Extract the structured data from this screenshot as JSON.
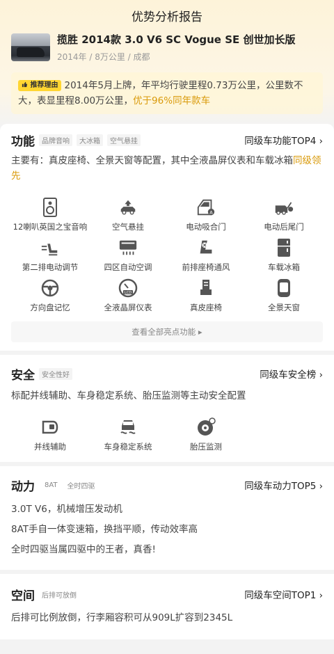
{
  "page": {
    "title": "优势分析报告"
  },
  "car": {
    "name": "揽胜 2014款 3.0 V6 SC Vogue SE 创世加长版",
    "meta": "2014年 / 8万公里 / 成都"
  },
  "reason": {
    "badge": "推荐理由",
    "text": "2014年5月上牌，年平均行驶里程0.73万公里，公里数不大，表显里程8.00万公里，",
    "highlight": "优于96%同年款车"
  },
  "function": {
    "title": "功能",
    "tags": [
      "品牌音响",
      "大冰箱",
      "空气悬挂"
    ],
    "rank_link": "同级车功能TOP4 ›",
    "desc": "主要有：真皮座椅、全景天窗等配置，其中全液晶屏仪表和车载冰箱",
    "desc_highlight": "同级领先",
    "features": [
      {
        "label": "12喇叭英国之宝音响",
        "icon": "speaker-icon"
      },
      {
        "label": "空气悬挂",
        "icon": "air-suspension-icon"
      },
      {
        "label": "电动吸合门",
        "icon": "soft-close-door-icon"
      },
      {
        "label": "电动后尾门",
        "icon": "power-tailgate-icon"
      },
      {
        "label": "第二排电动调节",
        "icon": "power-seat-icon"
      },
      {
        "label": "四区自动空调",
        "icon": "climate-control-icon"
      },
      {
        "label": "前排座椅通风",
        "icon": "seat-ventilation-icon"
      },
      {
        "label": "车载冰箱",
        "icon": "fridge-icon"
      },
      {
        "label": "方向盘记忆",
        "icon": "steering-wheel-icon"
      },
      {
        "label": "全液晶屏仪表",
        "icon": "lcd-dashboard-icon"
      },
      {
        "label": "真皮座椅",
        "icon": "leather-seat-icon"
      },
      {
        "label": "全景天窗",
        "icon": "sunroof-icon"
      }
    ],
    "more": "查看全部亮点功能 ▸"
  },
  "safety": {
    "title": "安全",
    "tag": "安全性好",
    "rank_link": "同级车安全榜 ›",
    "desc": "标配并线辅助、车身稳定系统、胎压监测等主动安全配置",
    "features": [
      {
        "label": "并线辅助",
        "icon": "lane-assist-icon"
      },
      {
        "label": "车身稳定系统",
        "icon": "stability-icon"
      },
      {
        "label": "胎压监测",
        "icon": "tire-pressure-icon"
      }
    ]
  },
  "power": {
    "title": "动力",
    "tags": [
      "8AT",
      "全时四驱"
    ],
    "rank_link": "同级车动力TOP5 ›",
    "lines": [
      "3.0T V6，机械增压发动机",
      "8AT手自一体变速箱，换挡平顺，传动效率高",
      "全时四驱当属四驱中的王者，真香!"
    ]
  },
  "space": {
    "title": "空间",
    "tag": "后排可放倒",
    "rank_link": "同级车空间TOP1 ›",
    "desc": "后排可比例放倒，行李厢容积可从909L扩容到2345L"
  },
  "colors": {
    "accent": "#d99a0a",
    "badge": "#ffd632"
  }
}
